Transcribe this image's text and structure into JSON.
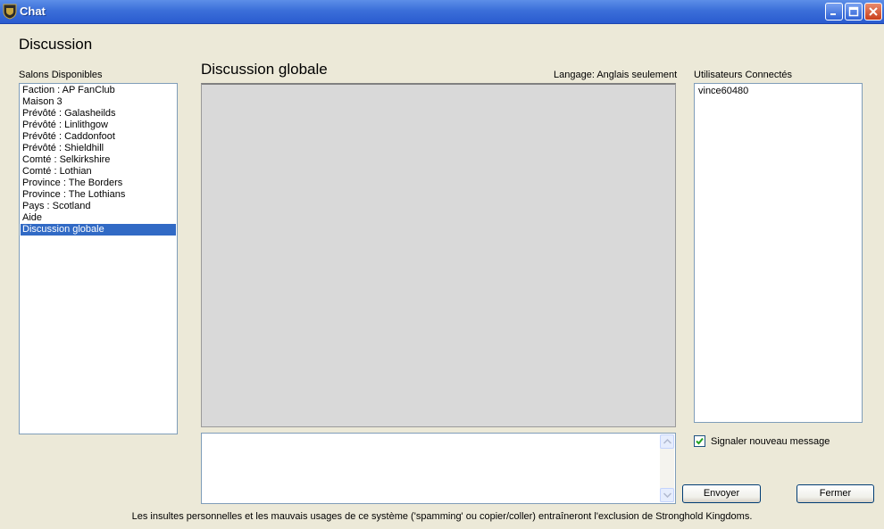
{
  "window": {
    "title": "Chat"
  },
  "page": {
    "heading": "Discussion"
  },
  "channels": {
    "label": "Salons Disponibles",
    "items": [
      "Faction : AP FanClub",
      "Maison 3",
      "Prévôté : Galasheilds",
      "Prévôté : Linlithgow",
      "Prévôté : Caddonfoot",
      "Prévôté : Shieldhill",
      "Comté : Selkirkshire",
      "Comté : Lothian",
      "Province : The Borders",
      "Province : The Lothians",
      "Pays : Scotland",
      "Aide",
      "Discussion globale"
    ],
    "selected": "Discussion globale"
  },
  "chat": {
    "title": "Discussion globale",
    "language": "Langage: Anglais seulement",
    "message_input": ""
  },
  "users": {
    "label": "Utilisateurs Connectés",
    "items": [
      "vince60480"
    ]
  },
  "notify": {
    "label": "Signaler nouveau message",
    "checked": true
  },
  "buttons": {
    "send": "Envoyer",
    "close": "Fermer"
  },
  "footer": {
    "notice": "Les insultes personnelles et les mauvais usages de ce système ('spamming' ou copier/coller) entraîneront l'exclusion de Stronghold Kingdoms."
  },
  "colors": {
    "titlebar": "#2a5bcf",
    "selection": "#316ac5",
    "background": "#ece9d8",
    "chat_area": "#d9d9d9"
  },
  "icons": [
    "shield-app-icon",
    "minimize-icon",
    "maximize-icon",
    "close-icon",
    "scroll-up-arrow-icon",
    "scroll-down-arrow-icon",
    "checkmark-icon"
  ]
}
